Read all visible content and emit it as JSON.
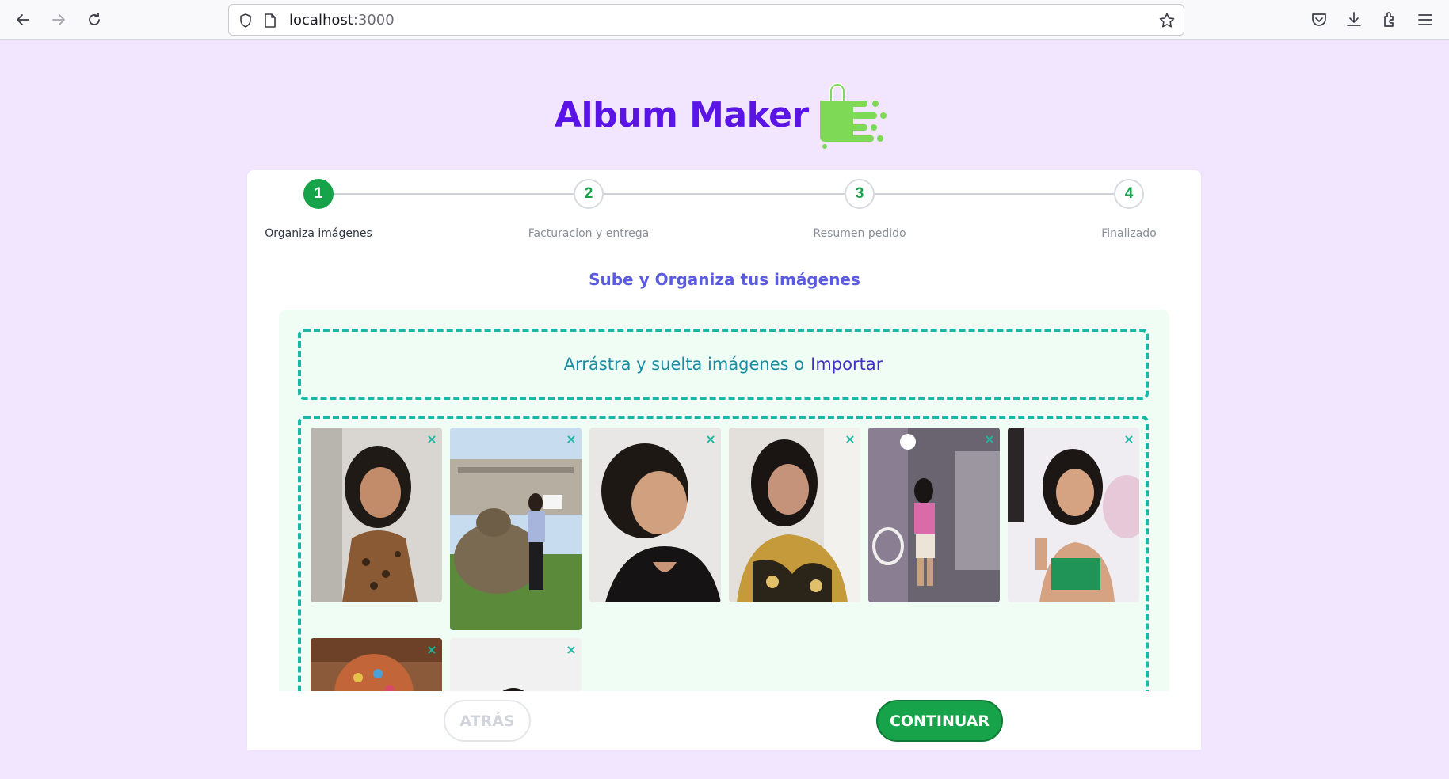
{
  "browser": {
    "url_host": "localhost",
    "url_port": ":3000"
  },
  "brand": {
    "title": "Album Maker",
    "title_color": "#5b14e6",
    "logo_color": "#7ed957"
  },
  "stepper": {
    "steps": [
      {
        "number": "1",
        "label": "Organiza imágenes",
        "active": true
      },
      {
        "number": "2",
        "label": "Facturacion y entrega",
        "active": false
      },
      {
        "number": "3",
        "label": "Resumen pedido",
        "active": false
      },
      {
        "number": "4",
        "label": "Finalizado",
        "active": false
      }
    ],
    "active_color": "#17a34a"
  },
  "main": {
    "section_title": "Sube y Organiza tus imágenes",
    "dropzone_text": "Arrástra y suelta imágenes o",
    "dropzone_link": "Importar",
    "remove_symbol": "×"
  },
  "footer": {
    "back_label": "ATRÁS",
    "continue_label": "CONTINUAR"
  }
}
